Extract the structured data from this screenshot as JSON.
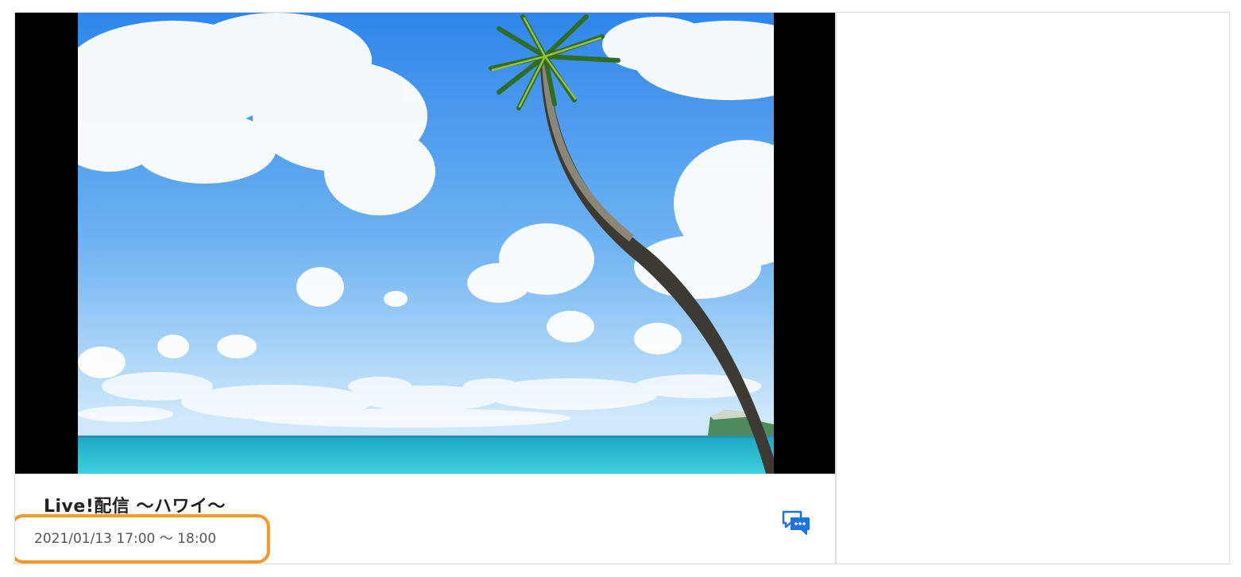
{
  "video": {
    "thumbnail": "beach-palm-tree-icon"
  },
  "stream": {
    "title": "Live!配信 ～ハワイ～",
    "time": "2021/01/13 17:00 ～ 18:00"
  },
  "actions": {
    "chat_icon": "chat-bubbles-icon"
  },
  "colors": {
    "highlight": "#f7982a",
    "chat_icon": "#1a73e8",
    "sky_top": "#2f86ea",
    "sea": "#2ec3d8"
  }
}
